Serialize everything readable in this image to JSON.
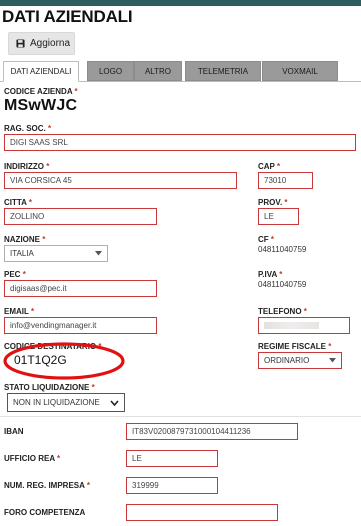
{
  "page": {
    "title": "DATI AZIENDALI"
  },
  "toolbar": {
    "update_label": "Aggiorna"
  },
  "tabs": [
    {
      "label": "DATI AZIENDALI",
      "active": true
    },
    {
      "label": "LOGO",
      "active": false
    },
    {
      "label": "ALTRO",
      "active": false
    },
    {
      "label": "TELEMETRIA",
      "active": false
    },
    {
      "label": "VOXMAIL",
      "active": false
    }
  ],
  "form": {
    "codice_azienda": {
      "label": "CODICE AZIENDA",
      "value": "MSwWJC"
    },
    "rag_soc": {
      "label": "RAG. SOC.",
      "value": "DIGI SAAS SRL"
    },
    "indirizzo": {
      "label": "INDIRIZZO",
      "value": "VIA CORSICA 45"
    },
    "cap": {
      "label": "CAP",
      "value": "73010"
    },
    "citta": {
      "label": "CITTA",
      "value": "ZOLLINO"
    },
    "prov": {
      "label": "PROV.",
      "value": "LE"
    },
    "nazione": {
      "label": "NAZIONE",
      "value": "ITALIA"
    },
    "cf": {
      "label": "CF",
      "value": "04811040759"
    },
    "pec": {
      "label": "PEC",
      "value": "digisaas@pec.it"
    },
    "piva": {
      "label": "P.IVA",
      "value": "04811040759"
    },
    "email": {
      "label": "EMAIL",
      "value": "info@vendingmanager.it"
    },
    "telefono": {
      "label": "TELEFONO",
      "value": ""
    },
    "codice_destinatario": {
      "label": "CODICE DESTINATARIO",
      "value": "01T1Q2G"
    },
    "regime_fiscale": {
      "label": "REGIME FISCALE",
      "value": "ORDINARIO"
    },
    "stato_liquidazione": {
      "label": "STATO LIQUIDAZIONE",
      "value": "NON IN LIQUIDAZIONE"
    },
    "iban": {
      "label": "IBAN",
      "value": "IT83V0200879731000104411236"
    },
    "ufficio_rea": {
      "label": "UFFICIO REA",
      "value": "LE"
    },
    "num_reg_impresa": {
      "label": "NUM. REG. IMPRESA",
      "value": "319999"
    },
    "foro_competenza": {
      "label": "FORO COMPETENZA",
      "value": ""
    }
  },
  "colors": {
    "accent_strip": "#2e5e5b",
    "required_border": "#c83838",
    "annotation": "#e11111"
  },
  "icons": {
    "update": "floppy-disk-icon",
    "dropdown": "chevron-down-icon"
  }
}
